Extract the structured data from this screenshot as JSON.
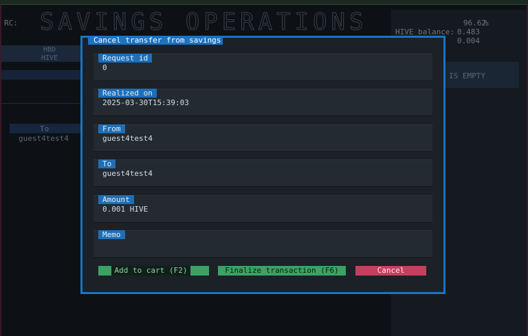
{
  "background": {
    "title": "SAVINGS OPERATIONS",
    "right_panel": {
      "rc_label": "RC:",
      "rc_value": "96.62",
      "rc_unit": "%",
      "hive_balance_label": "HIVE balance:",
      "hive_balance_value": "0.483",
      "third_value": "0.004"
    },
    "empty_text": "IS EMPTY",
    "left_tab": {
      "line1": "HBD",
      "line2": "HIVE"
    },
    "left_list": {
      "to_header": "To",
      "to_value": "guest4test4"
    }
  },
  "modal": {
    "title": "Cancel transfer from savings",
    "fields": [
      {
        "label": "Request id",
        "value": "0"
      },
      {
        "label": "Realized on",
        "value": "2025-03-30T15:39:03"
      },
      {
        "label": "From",
        "value": "guest4test4"
      },
      {
        "label": "To",
        "value": "guest4test4"
      },
      {
        "label": "Amount",
        "value": "0.001 HIVE"
      },
      {
        "label": "Memo",
        "value": ""
      }
    ],
    "buttons": {
      "add_to_cart": "Add to cart (F2)",
      "finalize": "Finalize transaction (F6)",
      "cancel": "Cancel"
    }
  },
  "colors": {
    "accent": "#1874c7",
    "label_bg": "#1e6fb8",
    "success": "#3aa363",
    "danger": "#c2415f"
  }
}
